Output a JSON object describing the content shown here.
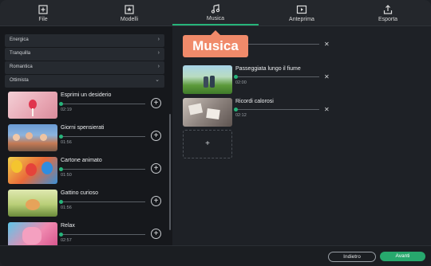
{
  "tabs": [
    {
      "label": "File",
      "icon": "file-add-icon"
    },
    {
      "label": "Modelli",
      "icon": "templates-icon"
    },
    {
      "label": "Musica",
      "icon": "music-note-icon",
      "active": true
    },
    {
      "label": "Anteprima",
      "icon": "preview-play-icon"
    },
    {
      "label": "Esporta",
      "icon": "export-icon"
    }
  ],
  "categories": [
    {
      "label": "Energica",
      "state": "collapsed"
    },
    {
      "label": "Tranquilla",
      "state": "collapsed"
    },
    {
      "label": "Romantica",
      "state": "collapsed"
    },
    {
      "label": "Ottimista",
      "state": "expanded"
    }
  ],
  "tracks": [
    {
      "title": "Esprimi un desiderio",
      "duration": "02:19"
    },
    {
      "title": "Giorni spensierati",
      "duration": "01:56"
    },
    {
      "title": "Cartone animato",
      "duration": "01:50"
    },
    {
      "title": "Gattino curioso",
      "duration": "01:56"
    },
    {
      "title": "Relax",
      "duration": "02:57"
    }
  ],
  "selected": [
    {
      "title": "",
      "duration": ""
    },
    {
      "title": "Passeggiata lungo il fiume",
      "duration": "02:00"
    },
    {
      "title": "Ricordi calorosi",
      "duration": "02:12"
    }
  ],
  "tooltip": {
    "text": "Musica"
  },
  "add_placeholder": "+",
  "add_track_symbol": "+",
  "remove_symbol": "✕",
  "footer": {
    "back_label": "Indietro",
    "next_label": "Avanti"
  },
  "colors": {
    "accent": "#26b47a",
    "tooltip": "#f08a6a",
    "next_button": "#27a86d"
  }
}
